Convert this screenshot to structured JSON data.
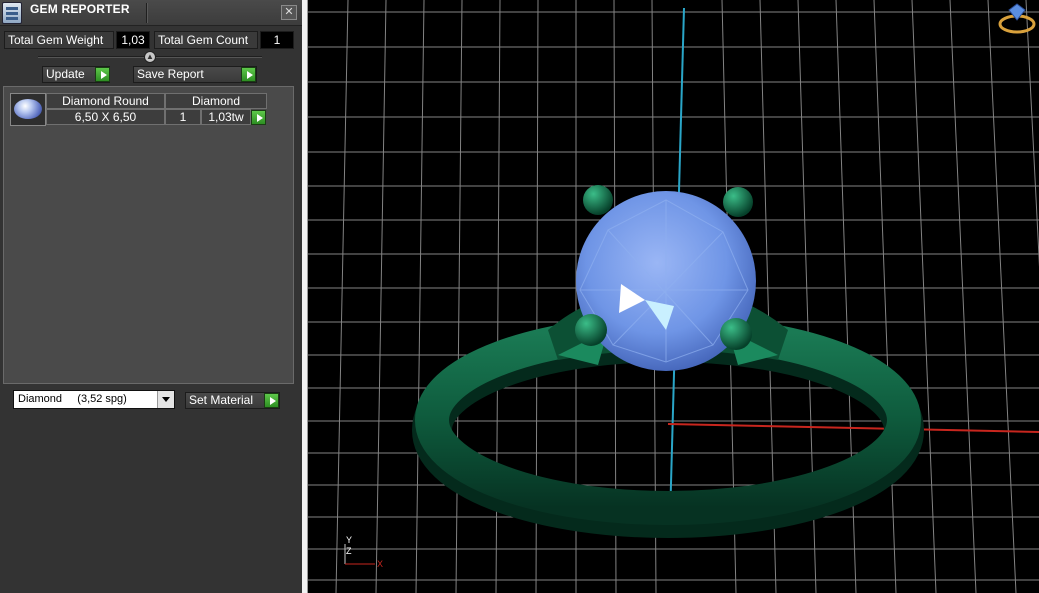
{
  "window": {
    "title": "GEM REPORTER",
    "close_glyph": "✕"
  },
  "summary": {
    "weight_label": "Total Gem Weight",
    "weight_value": "1,03",
    "count_label": "Total Gem Count",
    "count_value": "1"
  },
  "toolbar": {
    "update_label": "Update",
    "save_report_label": "Save Report"
  },
  "report": {
    "headers": [
      "Diamond Round",
      "Diamond"
    ],
    "row": {
      "size": "6,50 X 6,50",
      "count": "1",
      "weight": "1,03tw"
    }
  },
  "material": {
    "selected": "Diamond     (3,52 spg)",
    "set_label": "Set Material"
  },
  "viewport": {
    "axis_labels": {
      "y": "Y",
      "z": "Z",
      "x": "X"
    }
  },
  "colors": {
    "panel": "#333333",
    "play_button": "#3fae2e",
    "grid": "#9a9a9a",
    "ring_metal": "#0e5a3c",
    "gem": "#6f95e6",
    "axis_y": "#2aa6c8",
    "axis_x": "#c8261e"
  },
  "icons": [
    "gem-reporter-app-icon",
    "close-icon",
    "collapse-arrow-icon",
    "play-arrow-icon",
    "dropdown-arrow-icon",
    "ring-diamond-icon",
    "axis-triad-icon"
  ]
}
